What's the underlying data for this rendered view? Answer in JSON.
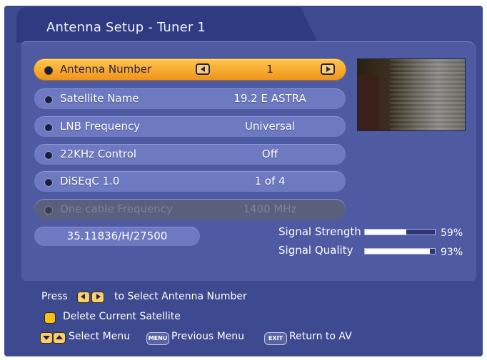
{
  "window": {
    "title": "Antenna Setup - Tuner 1"
  },
  "settings": [
    {
      "label": "Antenna Number",
      "value": "1",
      "state": "active",
      "has_arrows": true
    },
    {
      "label": "Satellite Name",
      "value": "19.2 E ASTRA",
      "state": "normal"
    },
    {
      "label": "LNB Frequency",
      "value": "Universal",
      "state": "normal"
    },
    {
      "label": "22KHz Control",
      "value": "Off",
      "state": "normal"
    },
    {
      "label": "DiSEqC 1.0",
      "value": "1 of 4",
      "state": "normal"
    },
    {
      "label": "One cable Frequency",
      "value": "1400 MHz",
      "state": "disabled"
    }
  ],
  "coordinates": "35.11836/H/27500",
  "signal": {
    "strength_label": "Signal Strength",
    "strength_pct": 59,
    "strength_text": "59%",
    "quality_label": "Signal Quality",
    "quality_pct": 93,
    "quality_text": "93%"
  },
  "help": {
    "press": "Press",
    "select_antenna": "to Select Antenna Number",
    "delete_satellite": "Delete Current Satellite",
    "select_menu": "Select Menu",
    "menu_key": "MENU",
    "previous_menu": "Previous Menu",
    "exit_key": "EXIT",
    "return_av": "Return to AV"
  },
  "colors": {
    "background": "#3d4a8f",
    "row": "#6d79c0",
    "active_row": "#f0941a",
    "disabled_row": "#5a5f7c"
  }
}
